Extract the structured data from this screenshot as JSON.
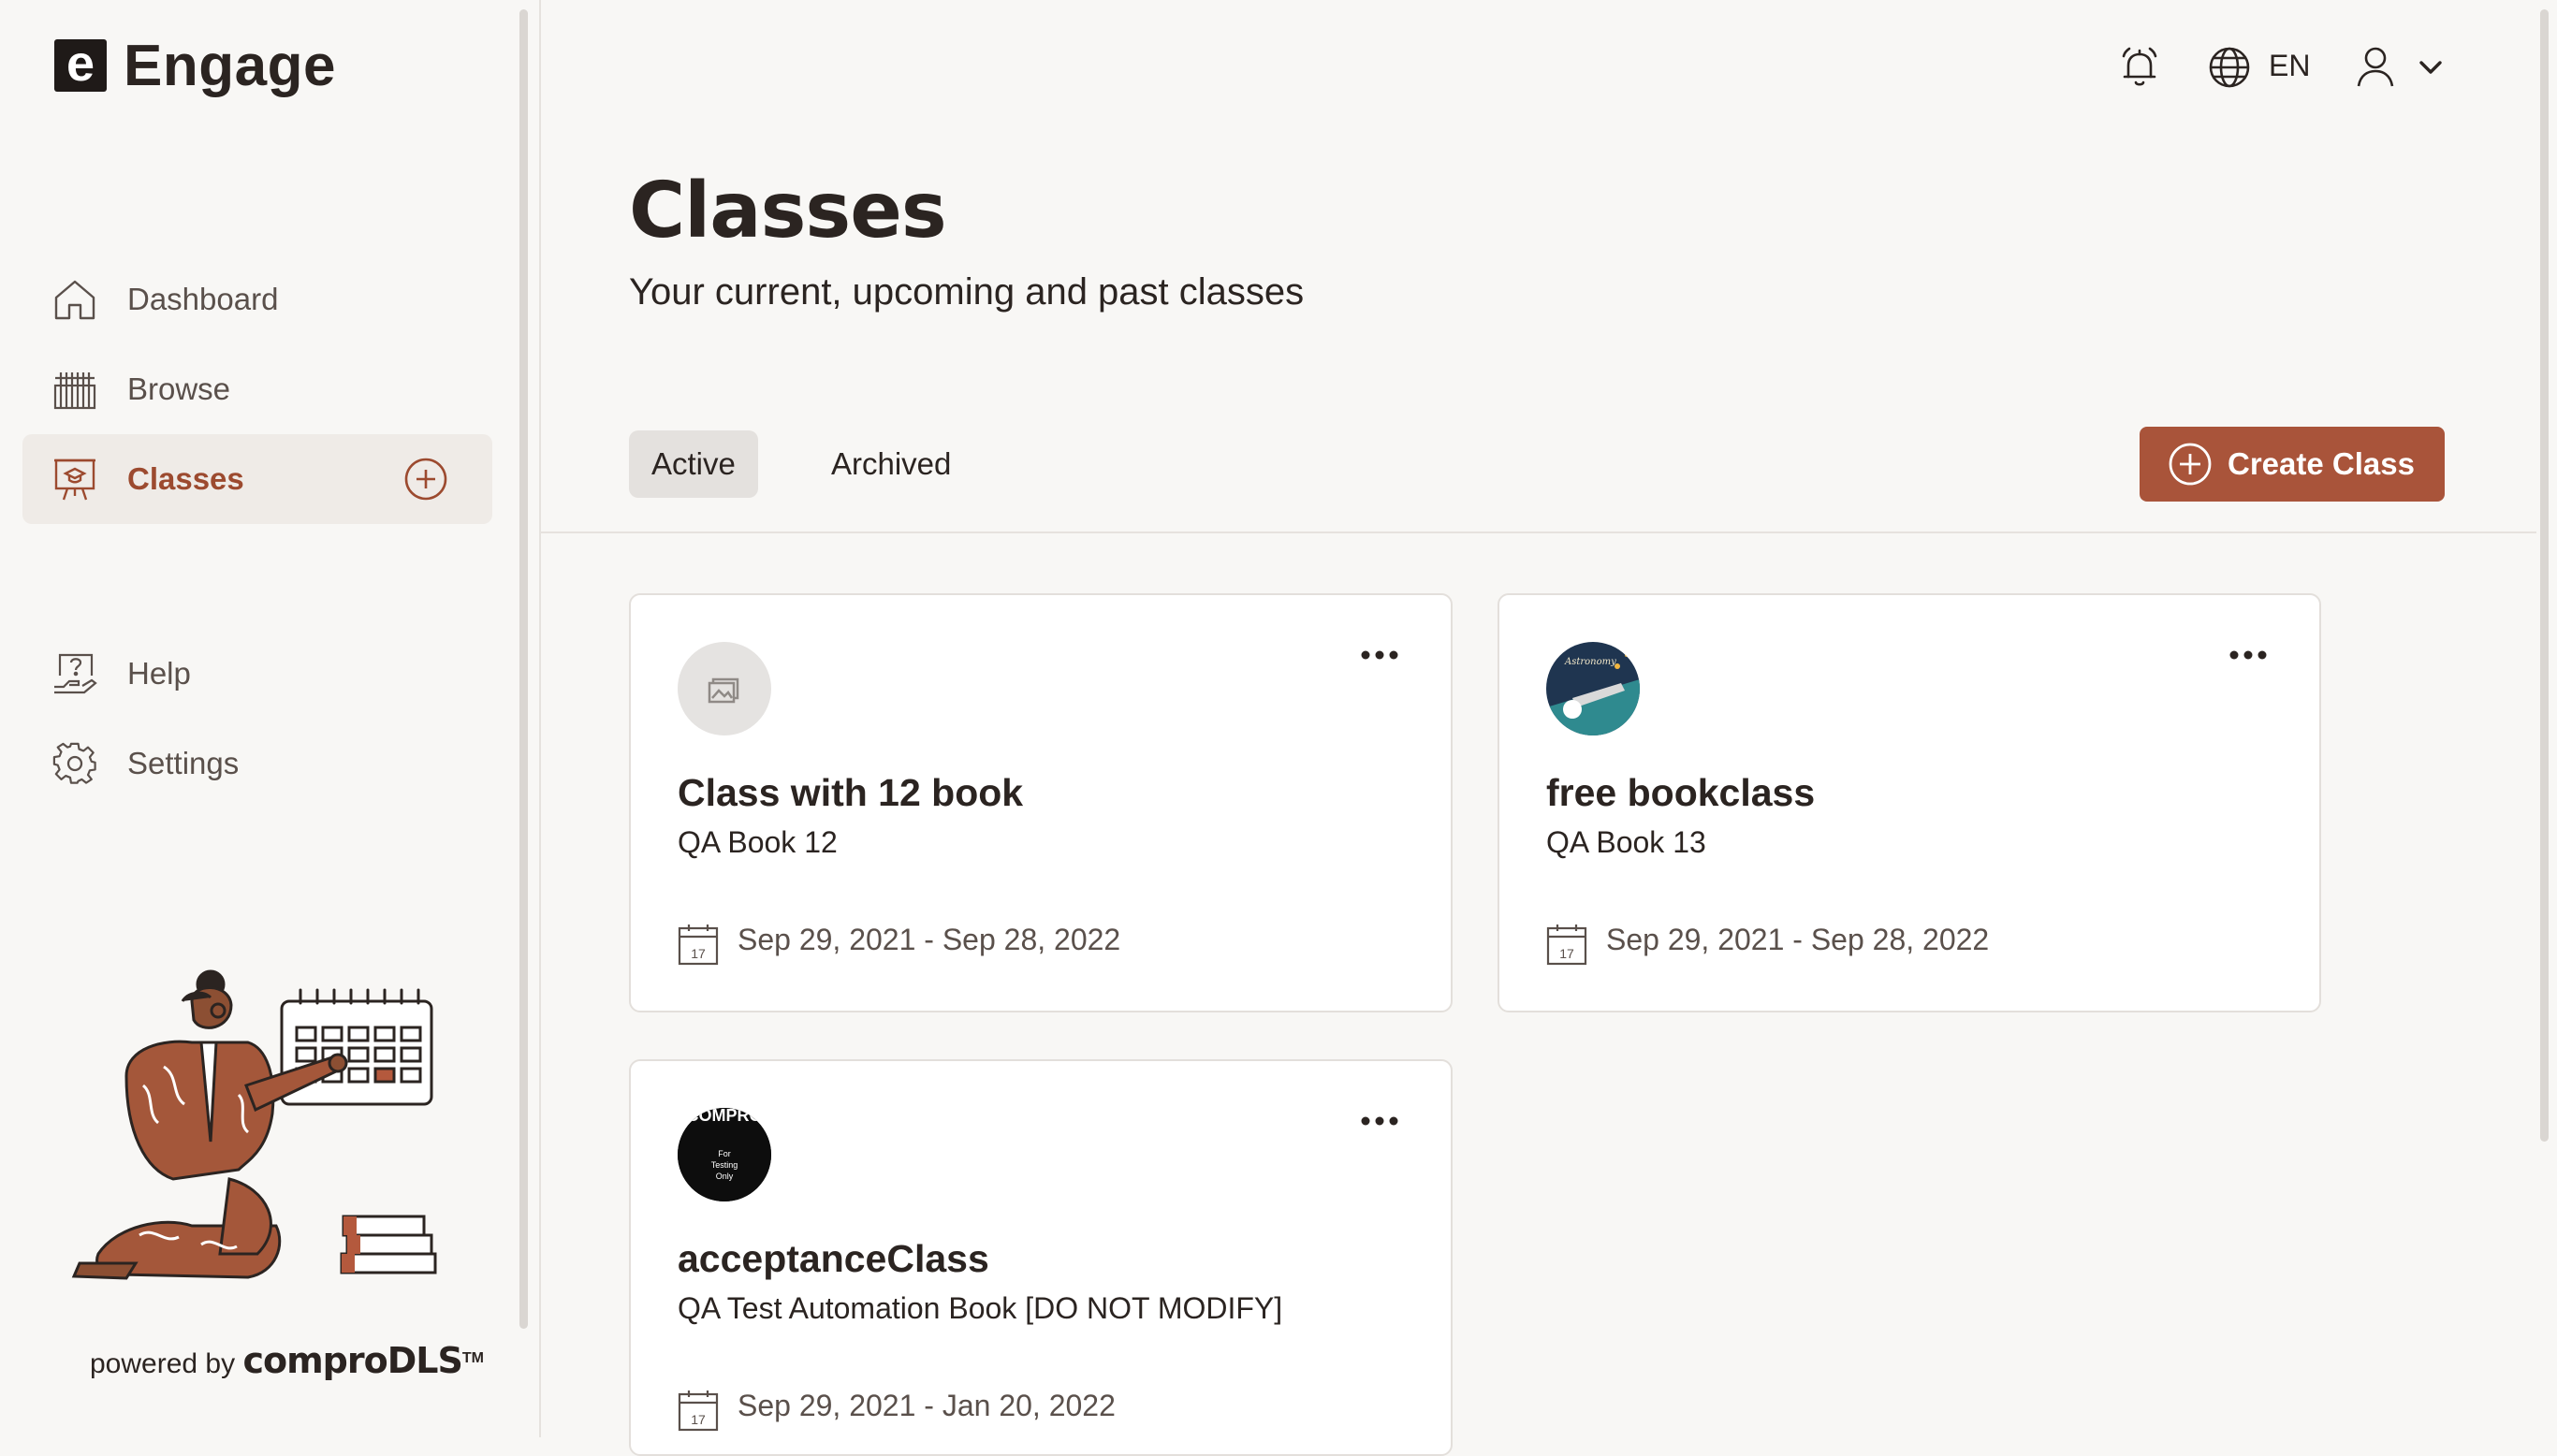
{
  "app": {
    "logo_letter": "e",
    "name": "Engage"
  },
  "sidebar": {
    "items": [
      {
        "label": "Dashboard",
        "icon": "home-icon"
      },
      {
        "label": "Browse",
        "icon": "books-icon"
      },
      {
        "label": "Classes",
        "icon": "classroom-icon",
        "active": true
      },
      {
        "label": "Help",
        "icon": "help-icon"
      },
      {
        "label": "Settings",
        "icon": "gear-icon"
      }
    ],
    "powered_prefix": "powered by",
    "powered_brand": "comproDLS",
    "powered_tm": "TM"
  },
  "header": {
    "language": "EN",
    "icons": [
      "bell-icon",
      "globe-icon",
      "user-icon",
      "chevron-down-icon"
    ]
  },
  "page": {
    "title": "Classes",
    "subtitle": "Your current, upcoming and past classes",
    "tabs": [
      {
        "label": "Active",
        "active": true
      },
      {
        "label": "Archived"
      }
    ],
    "create_label": "Create Class"
  },
  "classes": [
    {
      "name": "Class with 12 book",
      "book": "QA Book 12",
      "dates": "Sep 29, 2021 - Sep 28, 2022",
      "avatar": "placeholder-image-icon"
    },
    {
      "name": "free bookclass",
      "book": "QA Book 13",
      "dates": "Sep 29, 2021 - Sep 28, 2022",
      "avatar": "astronomy-thumbnail"
    },
    {
      "name": "acceptanceClass",
      "book": "QA Test Automation Book [DO NOT MODIFY]",
      "dates": "Sep 29, 2021 - Jan 20, 2022",
      "avatar": "compro-thumbnail",
      "avatar_text": [
        "COMPRO",
        "For",
        "Testing",
        "Only"
      ]
    }
  ],
  "colors": {
    "accent": "#a9543a",
    "active_nav_text": "#9c4a2f",
    "text": "#2b2421",
    "background": "#f8f7f5"
  }
}
